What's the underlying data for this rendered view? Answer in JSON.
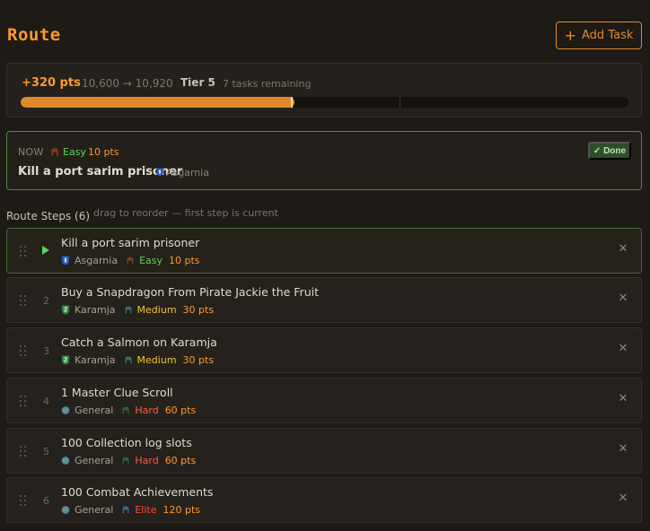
{
  "header": {
    "title": "Route",
    "add_task_label": "Add Task",
    "add_icon": "plus-icon"
  },
  "progress": {
    "points_gain": "+320 pts",
    "points_range": "10,600 → 10,920",
    "tier": "Tier 5",
    "tasks_remaining": "7 tasks remaining",
    "fill_fraction": 0.45,
    "marker_fraction": 0.445,
    "accent_color": "#e0892b"
  },
  "now": {
    "label": "NOW",
    "difficulty": "Easy",
    "points": "10 pts",
    "task": "Kill a port sarim prisoner",
    "region": "Asgarnia",
    "done_label": "✓ Done"
  },
  "steps_section": {
    "title": "Route Steps (6)",
    "hint": "drag to reorder — first step is current"
  },
  "steps": [
    {
      "number": "",
      "current": true,
      "title": "Kill a port sarim prisoner",
      "region": "Asgarnia",
      "region_icon": "asgarnia-shield-icon",
      "difficulty": "Easy",
      "difficulty_class": "d-easy",
      "points": "10 pts"
    },
    {
      "number": "2",
      "current": false,
      "title": "Buy a Snapdragon From Pirate Jackie the Fruit",
      "region": "Karamja",
      "region_icon": "karamja-shield-icon",
      "difficulty": "Medium",
      "difficulty_class": "d-medium",
      "points": "30 pts"
    },
    {
      "number": "3",
      "current": false,
      "title": "Catch a Salmon on Karamja",
      "region": "Karamja",
      "region_icon": "karamja-shield-icon",
      "difficulty": "Medium",
      "difficulty_class": "d-medium",
      "points": "30 pts"
    },
    {
      "number": "4",
      "current": false,
      "title": "1 Master Clue Scroll",
      "region": "General",
      "region_icon": "globe-icon",
      "difficulty": "Hard",
      "difficulty_class": "d-hard",
      "points": "60 pts"
    },
    {
      "number": "5",
      "current": false,
      "title": "100 Collection log slots",
      "region": "General",
      "region_icon": "globe-icon",
      "difficulty": "Hard",
      "difficulty_class": "d-hard",
      "points": "60 pts"
    },
    {
      "number": "6",
      "current": false,
      "title": "100 Combat Achievements",
      "region": "General",
      "region_icon": "globe-icon",
      "difficulty": "Elite",
      "difficulty_class": "d-elite",
      "points": "120 pts"
    }
  ],
  "icons": {
    "drag": "drag-handle-icon",
    "remove": "close-icon",
    "current": "play-icon",
    "difficulty": "helmet-icon"
  }
}
